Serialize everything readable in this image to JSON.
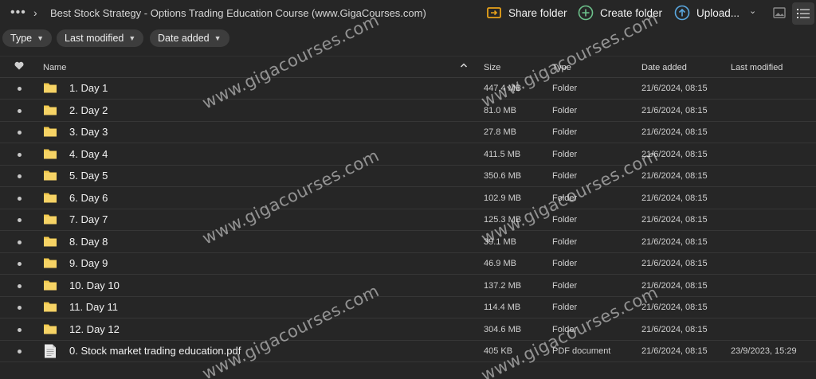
{
  "breadcrumb": {
    "more_label": "•••",
    "separator": "›",
    "title": "Best Stock Strategy - Options Trading Education Course (www.GigaCourses.com)"
  },
  "toolbar": {
    "share_label": "Share folder",
    "create_label": "Create folder",
    "upload_label": "Upload...",
    "upload_caret": "⌄",
    "accent_share": "#e8a21a",
    "accent_create": "#6cc08a",
    "accent_upload": "#5aa8e0"
  },
  "filters": {
    "type_label": "Type",
    "modified_label": "Last modified",
    "added_label": "Date added"
  },
  "table": {
    "headers": {
      "name": "Name",
      "size": "Size",
      "type": "Type",
      "added": "Date added",
      "modified": "Last modified"
    },
    "rows": [
      {
        "name": "1. Day 1",
        "size": "447.4 MB",
        "type": "Folder",
        "added": "21/6/2024, 08:15",
        "modified": "",
        "icon": "folder-icon"
      },
      {
        "name": "2. Day 2",
        "size": "81.0 MB",
        "type": "Folder",
        "added": "21/6/2024, 08:15",
        "modified": "",
        "icon": "folder-icon"
      },
      {
        "name": "3. Day 3",
        "size": "27.8 MB",
        "type": "Folder",
        "added": "21/6/2024, 08:15",
        "modified": "",
        "icon": "folder-icon"
      },
      {
        "name": "4. Day 4",
        "size": "411.5 MB",
        "type": "Folder",
        "added": "21/6/2024, 08:15",
        "modified": "",
        "icon": "folder-icon"
      },
      {
        "name": "5. Day 5",
        "size": "350.6 MB",
        "type": "Folder",
        "added": "21/6/2024, 08:15",
        "modified": "",
        "icon": "folder-icon"
      },
      {
        "name": "6. Day 6",
        "size": "102.9 MB",
        "type": "Folder",
        "added": "21/6/2024, 08:15",
        "modified": "",
        "icon": "folder-icon"
      },
      {
        "name": "7. Day 7",
        "size": "125.3 MB",
        "type": "Folder",
        "added": "21/6/2024, 08:15",
        "modified": "",
        "icon": "folder-icon"
      },
      {
        "name": "8. Day 8",
        "size": "39.1 MB",
        "type": "Folder",
        "added": "21/6/2024, 08:15",
        "modified": "",
        "icon": "folder-icon"
      },
      {
        "name": "9. Day 9",
        "size": "46.9 MB",
        "type": "Folder",
        "added": "21/6/2024, 08:15",
        "modified": "",
        "icon": "folder-icon"
      },
      {
        "name": "10. Day 10",
        "size": "137.2 MB",
        "type": "Folder",
        "added": "21/6/2024, 08:15",
        "modified": "",
        "icon": "folder-icon"
      },
      {
        "name": "11. Day 11",
        "size": "114.4 MB",
        "type": "Folder",
        "added": "21/6/2024, 08:15",
        "modified": "",
        "icon": "folder-icon"
      },
      {
        "name": "12. Day 12",
        "size": "304.6 MB",
        "type": "Folder",
        "added": "21/6/2024, 08:15",
        "modified": "",
        "icon": "folder-icon"
      },
      {
        "name": "0. Stock market trading education.pdf",
        "size": "405 KB",
        "type": "PDF document",
        "added": "21/6/2024, 08:15",
        "modified": "23/9/2023, 15:29",
        "icon": "pdf-file-icon"
      }
    ]
  },
  "watermark": {
    "text": "www.gigacourses.com",
    "color": "#ebebeb"
  },
  "colors": {
    "background": "#262626",
    "folder": "#f2c94c",
    "chip": "#3d3d3d"
  }
}
